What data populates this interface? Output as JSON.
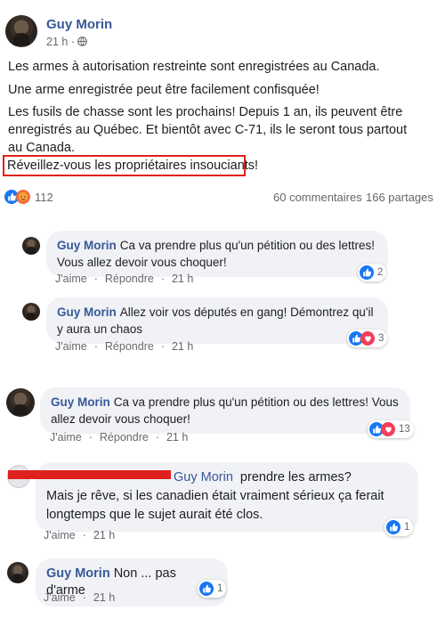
{
  "post": {
    "author": "Guy Morin",
    "time": "21 h",
    "dot": "·",
    "lines": [
      "Les armes à autorisation restreinte sont enregistrées au Canada.",
      "Une arme enregistrée peut être facilement confisquée!",
      "Les fusils de chasse sont les prochains! Depuis 1 an, ils peuvent être enregistrés au Québec. Et bientôt avec C-71, ils le seront tous partout au Canada.",
      "Réveillez-vous les propriétaires insouciants!"
    ],
    "reaction_count": "112",
    "comments_count": "60 commentaires",
    "shares_count": "166 partages"
  },
  "actions": {
    "like": "J'aime",
    "reply": "Répondre",
    "time": "21 h"
  },
  "comments": [
    {
      "author": "Guy Morin",
      "text": "Ca va prendre plus qu'un pétition ou des lettres! Vous allez devoir vous choquer!",
      "reactions": "2"
    },
    {
      "author": "Guy Morin",
      "text": "Allez voir vos députés en gang! Démontrez qu'il y aura un chaos",
      "reactions": "3"
    },
    {
      "author": "Guy Morin",
      "text": "Ca va prendre plus qu'un pétition ou des lettres! Vous allez devoir vous choquer!",
      "reactions": "13"
    },
    {
      "author": "Guy Morin",
      "text_first": "prendre les armes?",
      "text_rest": "Mais je rêve, si les canadien était vraiment sérieux ça ferait longtemps que le sujet aurait été clos.",
      "reactions": "1"
    },
    {
      "author": "Guy Morin",
      "text": "Non ... pas d'arme",
      "reactions": "1"
    }
  ],
  "colors": {
    "link": "#385898",
    "like": "#1877f2",
    "heart": "#f33e58",
    "redact": "#e0201c",
    "highlight_box": "#e0201c"
  }
}
